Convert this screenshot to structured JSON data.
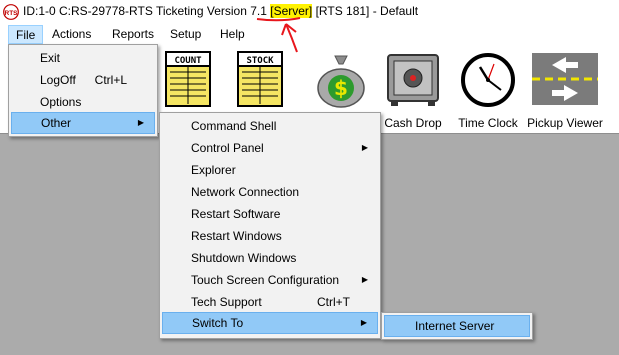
{
  "title": {
    "prefix": "ID:1-0 C:RS-29778-RTS Ticketing Version 7.1 ",
    "highlight": "[Server]",
    "suffix": " [RTS 181] - Default",
    "app_icon": "rts-logo-icon"
  },
  "menubar": [
    "File",
    "Actions",
    "Reports",
    "Setup",
    "Help"
  ],
  "toolbar": [
    {
      "label": "",
      "icon": "count-sheet-icon"
    },
    {
      "label": "",
      "icon": "stock-sheet-icon"
    },
    {
      "label": "",
      "icon": "money-bag-icon"
    },
    {
      "label": "Cash Drop",
      "icon": "safe-icon"
    },
    {
      "label": "Time Clock",
      "icon": "clock-icon"
    },
    {
      "label": "Pickup Viewer",
      "icon": "pickup-viewer-icon"
    }
  ],
  "file_menu": [
    {
      "label": "Exit",
      "shortcut": ""
    },
    {
      "label": "LogOff",
      "shortcut": "Ctrl+L"
    },
    {
      "label": "Options",
      "shortcut": ""
    },
    {
      "label": "Other",
      "shortcut": "",
      "submenu": true
    }
  ],
  "other_menu": [
    {
      "label": "Command Shell",
      "shortcut": ""
    },
    {
      "label": "Control Panel",
      "shortcut": "",
      "submenu": true
    },
    {
      "label": "Explorer",
      "shortcut": ""
    },
    {
      "label": "Network Connection",
      "shortcut": ""
    },
    {
      "label": "Restart Software",
      "shortcut": ""
    },
    {
      "label": "Restart Windows",
      "shortcut": ""
    },
    {
      "label": "Shutdown Windows",
      "shortcut": ""
    },
    {
      "label": "Touch Screen Configuration",
      "shortcut": "",
      "submenu": true
    },
    {
      "label": "Tech Support",
      "shortcut": "Ctrl+T"
    },
    {
      "label": "Switch To",
      "shortcut": "",
      "submenu": true
    }
  ],
  "switch_menu": [
    {
      "label": "Internet Server"
    }
  ],
  "toolbar_icon_text": {
    "count": "COUNT",
    "stock": "STOCK",
    "money": "$"
  },
  "colors": {
    "background": "#ababab",
    "highlight": "#91c9f7",
    "menubar_open": "#cce8ff",
    "annotation": "#e8161c",
    "server_highlight": "#fff200"
  }
}
